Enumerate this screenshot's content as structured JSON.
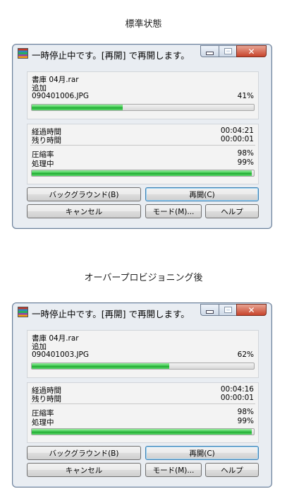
{
  "sections": [
    {
      "caption": "標準状態",
      "window": {
        "title": "一時停止中です。[再開] で再開します。",
        "archive_name": "書庫 04月.rar",
        "operation": "追加",
        "file_name": "090401006.JPG",
        "file_progress_text": "41%",
        "file_progress_value": 0.41,
        "elapsed_label": "経過時間",
        "elapsed_value": "00:04:21",
        "remaining_label": "残り時間",
        "remaining_value": "00:00:01",
        "ratio_label": "圧縮率",
        "ratio_value": "98%",
        "processed_label": "処理中",
        "processed_value": "99%",
        "total_progress_value": 0.99,
        "buttons": {
          "background": "バックグラウンド(B)",
          "resume": "再開(C)",
          "cancel": "キャンセル",
          "mode": "モード(M)...",
          "help": "ヘルプ"
        }
      }
    },
    {
      "caption": "オーバープロビジョニング後",
      "window": {
        "title": "一時停止中です。[再開] で再開します。",
        "archive_name": "書庫 04月.rar",
        "operation": "追加",
        "file_name": "090401003.JPG",
        "file_progress_text": "62%",
        "file_progress_value": 0.62,
        "elapsed_label": "経過時間",
        "elapsed_value": "00:04:16",
        "remaining_label": "残り時間",
        "remaining_value": "00:00:01",
        "ratio_label": "圧縮率",
        "ratio_value": "98%",
        "processed_label": "処理中",
        "processed_value": "99%",
        "total_progress_value": 0.99,
        "buttons": {
          "background": "バックグラウンド(B)",
          "resume": "再開(C)",
          "cancel": "キャンセル",
          "mode": "モード(M)...",
          "help": "ヘルプ"
        }
      }
    }
  ],
  "icons": {
    "app": "winrar-books-icon",
    "minimize": "minimize-icon",
    "maximize": "maximize-icon",
    "close": "close-icon"
  },
  "colors": {
    "progress_green": "#37c24a",
    "close_red": "#c7432b",
    "window_frame": "#e9edf2"
  }
}
